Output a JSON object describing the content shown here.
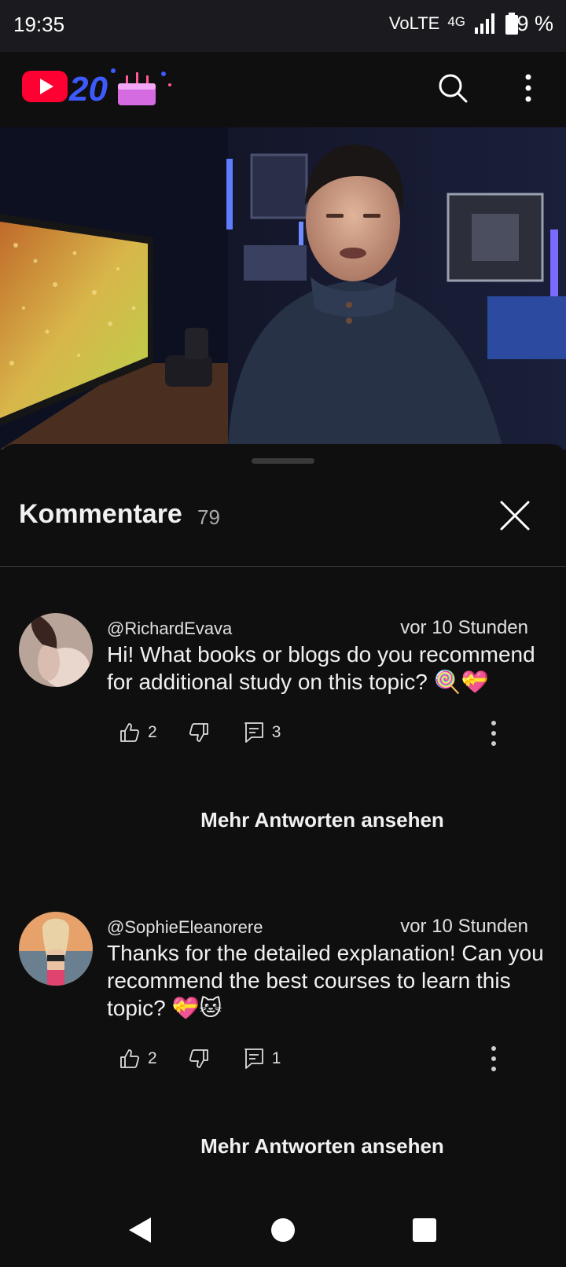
{
  "status": {
    "time": "19:35",
    "volte": "VoLTE",
    "network": "4G",
    "battery": "79 %"
  },
  "appbar": {
    "logo_text": "20",
    "icons": [
      "search-icon",
      "more-vert-icon"
    ]
  },
  "comments_panel": {
    "title": "Kommentare",
    "count": "79"
  },
  "comments": [
    {
      "author": "@RichardEvava",
      "time": "vor 10 Stunden",
      "text": "Hi! What books or blogs do you recommend for additional study on this topic? 🍭💝",
      "likes": "2",
      "replies": "3",
      "more_replies": "Mehr Antworten ansehen"
    },
    {
      "author": "@SophieEleanorere",
      "time": "vor 10 Stunden",
      "text": "Thanks for the detailed explanation! Can you recommend the best courses to learn this topic? 💝🐱",
      "likes": "2",
      "replies": "1",
      "more_replies": "Mehr Antworten ansehen"
    }
  ],
  "colors": {
    "background": "#0f0f0f",
    "youtube_red": "#ff0033",
    "logo_blue": "#3d5afe"
  }
}
